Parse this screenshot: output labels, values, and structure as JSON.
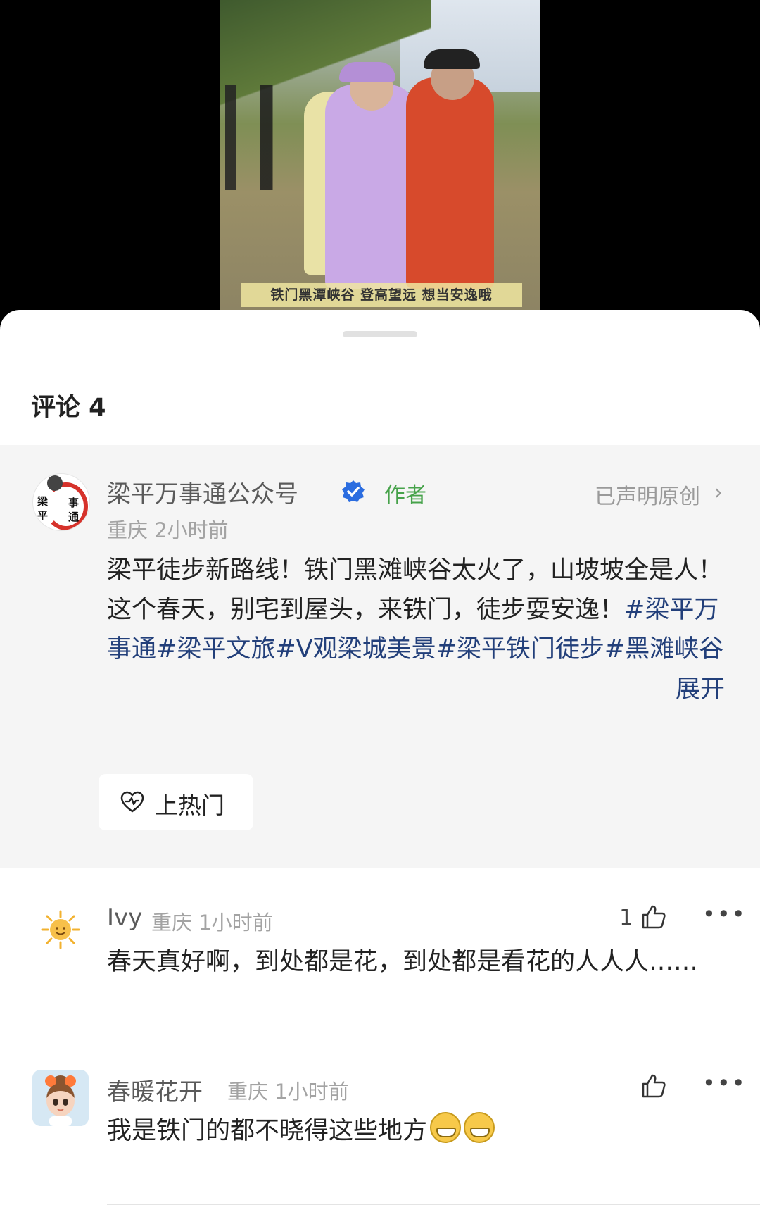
{
  "video": {
    "subtitle": "铁门黑潭峡谷 登高望远 想当安逸哦"
  },
  "sheet": {
    "title": "评论 4"
  },
  "author_comment": {
    "name": "梁平万事通公众号",
    "tag": "作者",
    "original_label": "已声明原创",
    "location": "重庆",
    "time": "2小时前",
    "text": "梁平徒步新路线！铁门黑滩峡谷太火了，山坡坡全是人！这个春天，别宅到屋头，来铁门，徒步耍安逸！",
    "tags": "#梁平万事通#梁平文旅#V观梁城美景#梁平铁门徒步#黑滩峡谷",
    "expand_label": "展开",
    "hot_button": "上热门",
    "avatar_text": [
      "梁",
      "平",
      "事",
      "通"
    ]
  },
  "comments": [
    {
      "name": "Ivy",
      "location": "重庆",
      "time": "1小时前",
      "likes": "1",
      "text": "春天真好啊，到处都是花，到处都是看花的人人人……",
      "avatar_icon": "sun-icon"
    },
    {
      "name": "春暖花开",
      "location": "重庆",
      "time": "1小时前",
      "likes": "",
      "text": "我是铁门的都不晓得这些地方",
      "emojis": [
        "grin-emoji",
        "grin-emoji"
      ],
      "avatar_icon": "girl-avatar"
    }
  ],
  "colors": {
    "hashtag": "#223f7a",
    "author_tag": "#46a24a",
    "verified": "#2b6de0"
  }
}
